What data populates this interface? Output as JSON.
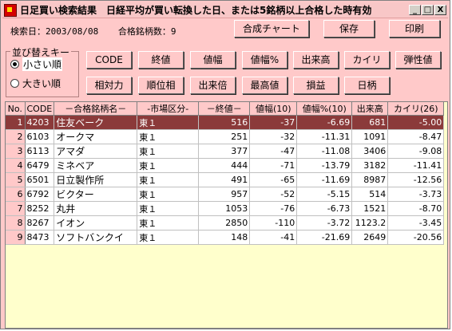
{
  "window": {
    "title": "日足買い検索結果　日経平均が買い転換した日、または5銘柄以上合格した時有効",
    "controls": {
      "minimize": "_",
      "maximize": "□",
      "close": "X"
    }
  },
  "info": {
    "search_date": "検索日：2003/08/08",
    "match_count": "合格銘柄数：9"
  },
  "toolbar": {
    "chart_label": "合成チャート",
    "save_label": "保存",
    "print_label": "印刷"
  },
  "sort": {
    "legend": "並び替えキー",
    "options": [
      {
        "label": "小さい順",
        "selected": true
      },
      {
        "label": "大きい順",
        "selected": false
      }
    ]
  },
  "sort_buttons": [
    "CODE",
    "終値",
    "値幅",
    "値幅%",
    "出来高",
    "カイリ",
    "弾性値",
    "相対力",
    "順位相",
    "出来倍",
    "最高値",
    "損益",
    "日柄"
  ],
  "table": {
    "columns": [
      "No.",
      "CODE",
      "－合格銘柄名－",
      "-市場区分-",
      "－終値－",
      "値幅(10)",
      "値幅%(10)",
      "出来高",
      "カイリ(26)"
    ],
    "rows": [
      [
        "1",
        "4203",
        "住友ベーク",
        "東１",
        "516",
        "-37",
        "-6.69",
        "681",
        "-5.00"
      ],
      [
        "2",
        "6103",
        "オークマ",
        "東１",
        "251",
        "-32",
        "-11.31",
        "1091",
        "-8.47"
      ],
      [
        "3",
        "6113",
        "アマダ",
        "東１",
        "377",
        "-47",
        "-11.08",
        "3406",
        "-9.08"
      ],
      [
        "4",
        "6479",
        "ミネベア",
        "東１",
        "444",
        "-71",
        "-13.79",
        "3182",
        "-11.41"
      ],
      [
        "5",
        "6501",
        "日立製作所",
        "東１",
        "491",
        "-65",
        "-11.69",
        "8987",
        "-12.56"
      ],
      [
        "6",
        "6792",
        "ビクター",
        "東１",
        "957",
        "-52",
        "-5.15",
        "514",
        "-3.73"
      ],
      [
        "7",
        "8252",
        "丸井",
        "東１",
        "1053",
        "-76",
        "-6.73",
        "1521",
        "-8.70"
      ],
      [
        "8",
        "8267",
        "イオン",
        "東１",
        "2850",
        "-110",
        "-3.72",
        "1123.2",
        "-3.45"
      ],
      [
        "9",
        "8473",
        "ソフトバンクイ",
        "東１",
        "148",
        "-41",
        "-21.69",
        "2649",
        "-20.56"
      ]
    ],
    "selected_row": 0
  }
}
